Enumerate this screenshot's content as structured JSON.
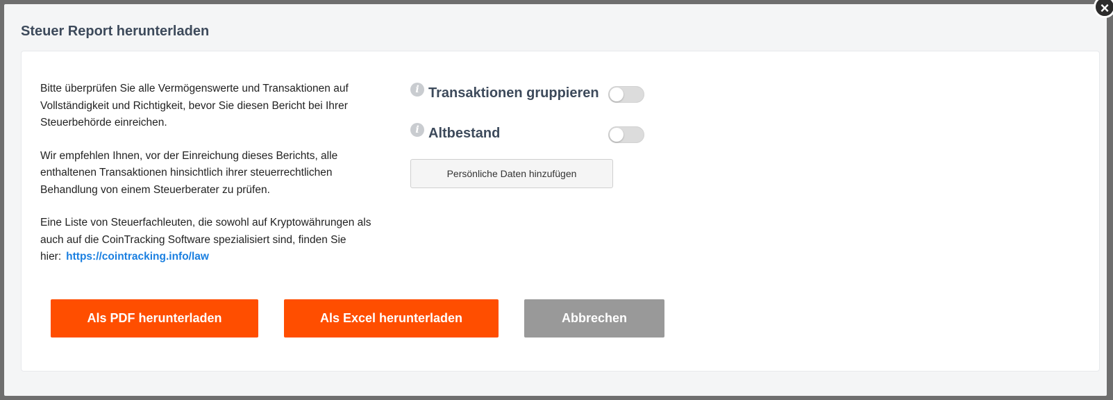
{
  "dialog": {
    "title": "Steuer Report herunterladen",
    "close_icon": "close-icon"
  },
  "description": {
    "paragraph1": "Bitte überprüfen Sie alle Vermögenswerte und Transaktionen auf Vollständigkeit und Richtigkeit, bevor Sie diesen Bericht bei Ihrer Steuerbehörde einreichen.",
    "paragraph2": "Wir empfehlen Ihnen, vor der Einreichung dieses Berichts, alle enthaltenen Transaktionen hinsichtlich ihrer steuerrechtlichen Behandlung von einem Steuerberater zu prüfen.",
    "paragraph3_prefix": "Eine Liste von Steuerfachleuten, die sowohl auf Kryptowährungen als auch auf die CoinTracking Software spezialisiert sind, finden Sie hier:",
    "link_text": "https://cointracking.info/law"
  },
  "options": [
    {
      "label": "Transaktionen gruppieren",
      "enabled": false,
      "icon": "info-icon"
    },
    {
      "label": "Altbestand",
      "enabled": false,
      "icon": "info-icon"
    }
  ],
  "personal_data_button": "Persönliche Daten hinzufügen",
  "buttons": {
    "pdf": "Als PDF herunterladen",
    "excel": "Als Excel herunterladen",
    "cancel": "Abbrechen"
  },
  "colors": {
    "primary": "#ff4e00",
    "secondary": "#999999",
    "link": "#1a7fe0",
    "heading": "#3d4a5b"
  }
}
